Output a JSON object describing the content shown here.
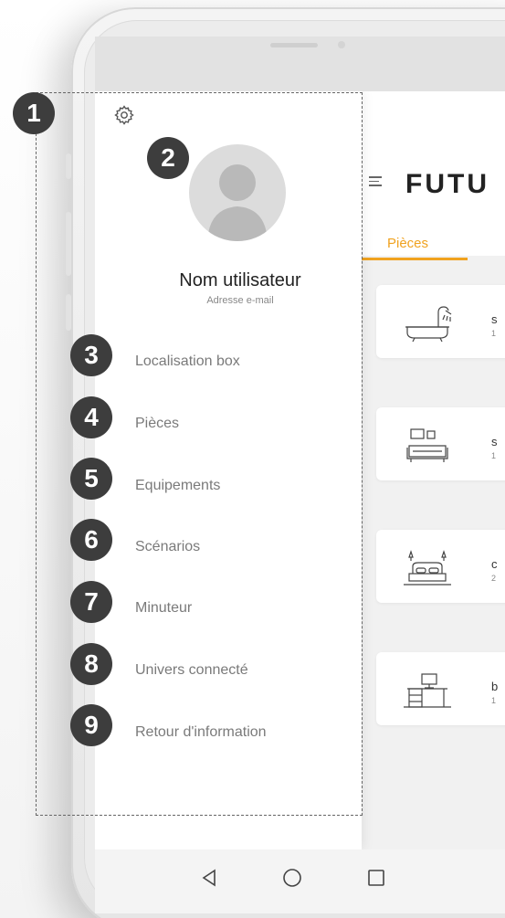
{
  "app": {
    "brand": "FUTU",
    "tab_label": "Pièces",
    "accent_color": "#f0a21f"
  },
  "rooms": [
    {
      "icon": "bathtub-icon",
      "letter": "s",
      "count": "1"
    },
    {
      "icon": "sofa-icon",
      "letter": "s",
      "count": "1"
    },
    {
      "icon": "bed-icon",
      "letter": "c",
      "count": "2"
    },
    {
      "icon": "desk-icon",
      "letter": "b",
      "count": "1"
    }
  ],
  "drawer": {
    "settings_icon": "gear-icon",
    "user_name": "Nom utilisateur",
    "user_email": "Adresse e-mail",
    "menu": [
      "Localisation box",
      "Pièces",
      "Equipements",
      "Scénarios",
      "Minuteur",
      "Univers connecté",
      "Retour d'information"
    ]
  },
  "badges": [
    "1",
    "2",
    "3",
    "4",
    "5",
    "6",
    "7",
    "8",
    "9"
  ],
  "navbar": {
    "back_icon": "back-triangle-icon",
    "home_icon": "home-circle-icon",
    "recents_icon": "recents-square-icon"
  }
}
